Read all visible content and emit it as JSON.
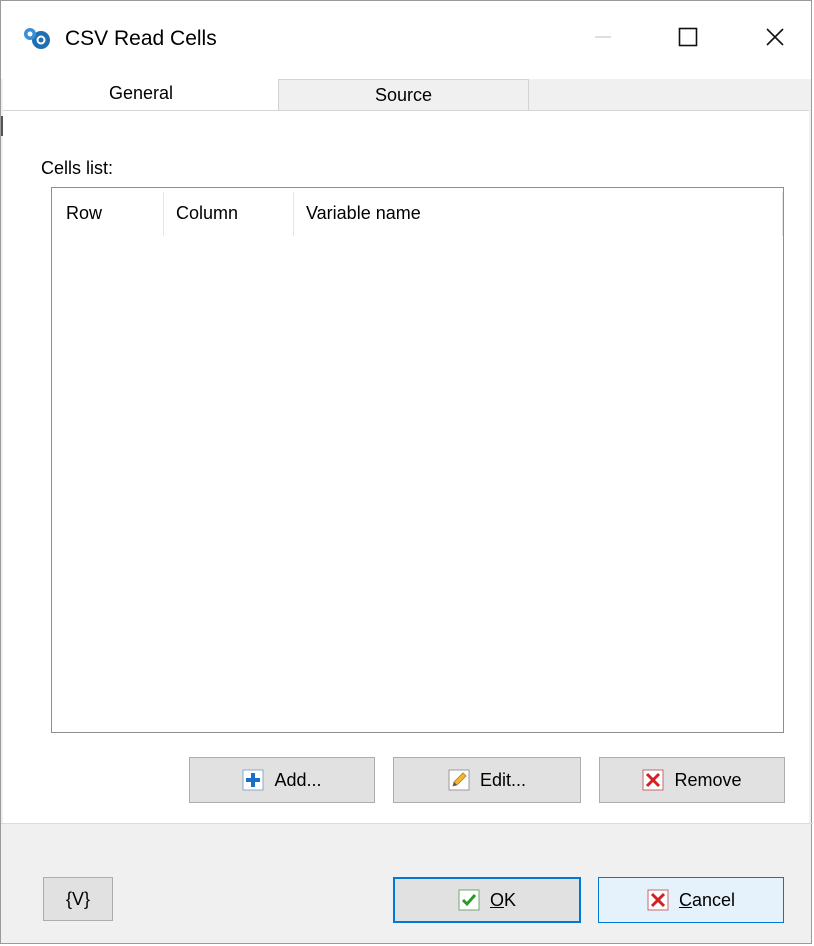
{
  "window": {
    "title": "CSV Read Cells",
    "controls": {
      "minimize_icon": "minimize-icon",
      "maximize_icon": "maximize-icon",
      "close_icon": "close-icon"
    }
  },
  "tabs": [
    {
      "label": "General",
      "selected": true
    },
    {
      "label": "Source",
      "selected": false
    }
  ],
  "general": {
    "cells_label": "Cells list:",
    "columns": [
      "Row",
      "Column",
      "Variable name"
    ],
    "rows": []
  },
  "buttons": {
    "add": "Add...",
    "edit": "Edit...",
    "remove": "Remove",
    "vars": "{V}",
    "ok_accel": "O",
    "ok_rest": "K",
    "cancel_accel": "C",
    "cancel_rest": "ancel"
  },
  "colors": {
    "accent": "#0078d7",
    "add_icon": "#1c6fc6",
    "remove_icon": "#d42020",
    "ok_icon": "#2b9a2b",
    "edit_icon": "#e5a21a"
  }
}
